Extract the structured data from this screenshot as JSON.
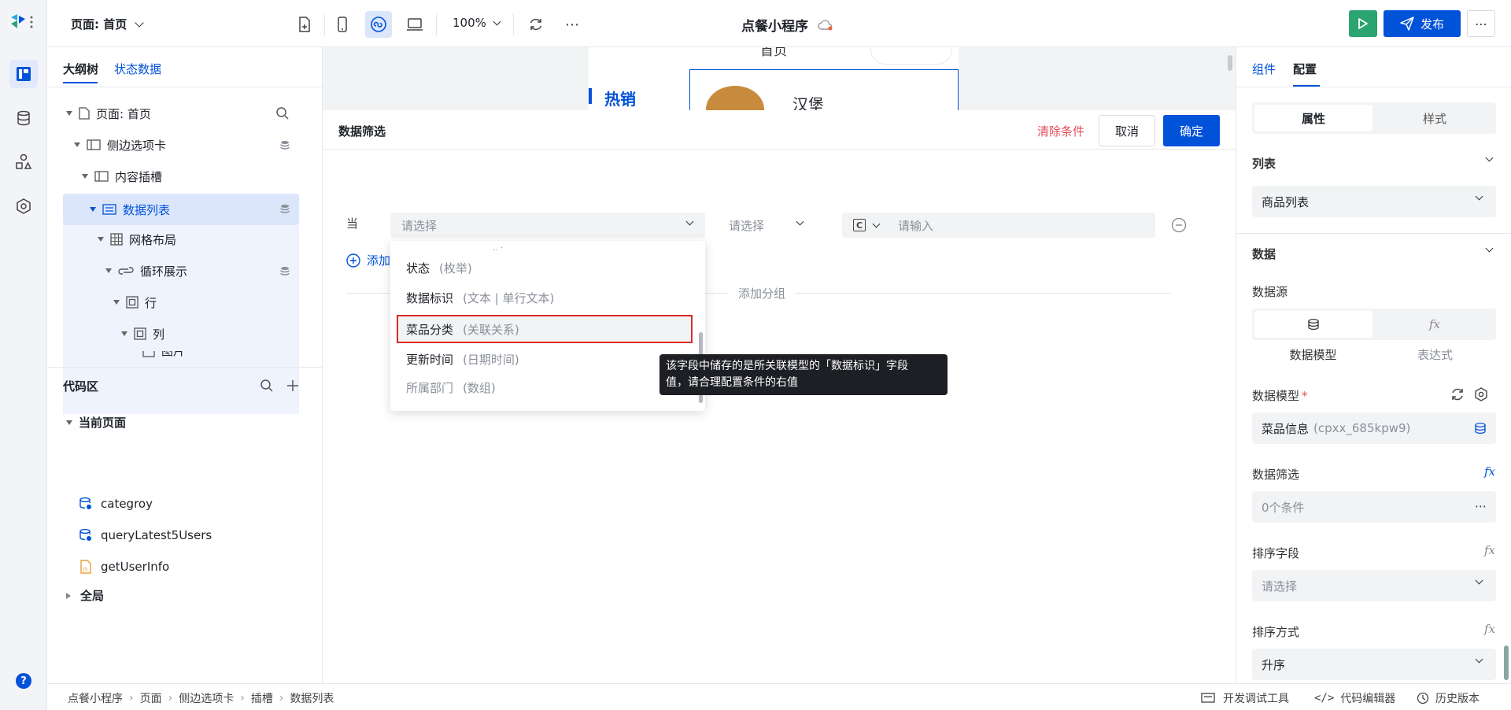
{
  "topbar": {
    "page_label": "页面: 首页",
    "zoom": "100%",
    "app_title": "点餐小程序",
    "publish_label": "发布",
    "more_label": "⋯"
  },
  "left_panel": {
    "tabs": [
      "大纲树",
      "状态数据"
    ],
    "tree": [
      {
        "label": "页面: 首页"
      },
      {
        "label": "侧边选项卡"
      },
      {
        "label": "内容插槽"
      },
      {
        "label": "数据列表"
      },
      {
        "label": "网格布局"
      },
      {
        "label": "循环展示"
      },
      {
        "label": "行"
      },
      {
        "label": "列"
      },
      {
        "label": "图片"
      }
    ],
    "code_section": {
      "title": "代码区",
      "group_current": "当前页面",
      "items": [
        "categroy",
        "queryLatest5Users",
        "getUserInfo"
      ],
      "group_global": "全局"
    }
  },
  "canvas": {
    "preview_title": "首页",
    "hot_label": "热销",
    "item_name": "汉堡"
  },
  "filter_dialog": {
    "title": "数据筛选",
    "clear_label": "清除条件",
    "cancel_label": "取消",
    "confirm_label": "确定",
    "when_label": "当",
    "field_placeholder": "请选择",
    "operator_placeholder": "请选择",
    "value_type": "C",
    "value_placeholder": "请输入",
    "add_condition": "添加",
    "add_group": "添加分组",
    "dropdown_items": [
      {
        "name": "状态",
        "type": "(枚举)"
      },
      {
        "name": "数据标识",
        "type": "(文本 | 单行文本)"
      },
      {
        "name": "菜品分类",
        "type": "(关联关系)"
      },
      {
        "name": "更新时间",
        "type": "(日期时间)"
      },
      {
        "name": "所属部门",
        "type": "(数组)"
      }
    ],
    "tooltip_line1": "该字段中储存的是所关联模型的「数据标识」字段",
    "tooltip_line2": "值，请合理配置条件的右值"
  },
  "right_panel": {
    "tabs": [
      "组件",
      "配置"
    ],
    "segments": [
      "属性",
      "样式"
    ],
    "list_section": "列表",
    "list_value": "商品列表",
    "data_section": "数据",
    "datasource_label": "数据源",
    "datasource_options": [
      "数据模型",
      "表达式"
    ],
    "model_label": "数据模型",
    "model_value": "菜品信息",
    "model_id": "(cpxx_685kpw9)",
    "filter_label": "数据筛选",
    "filter_value": "0个条件",
    "sort_field_label": "排序字段",
    "sort_field_placeholder": "请选择",
    "sort_order_label": "排序方式",
    "sort_order_value": "升序"
  },
  "bottombar": {
    "breadcrumb": [
      "点餐小程序",
      "页面",
      "侧边选项卡",
      "插槽",
      "数据列表"
    ],
    "dev_tools": "开发调试工具",
    "code_editor": "代码编辑器",
    "history": "历史版本"
  },
  "colors": {
    "accent": "#0052d9",
    "danger": "#e34d59",
    "green": "#2ba471"
  }
}
